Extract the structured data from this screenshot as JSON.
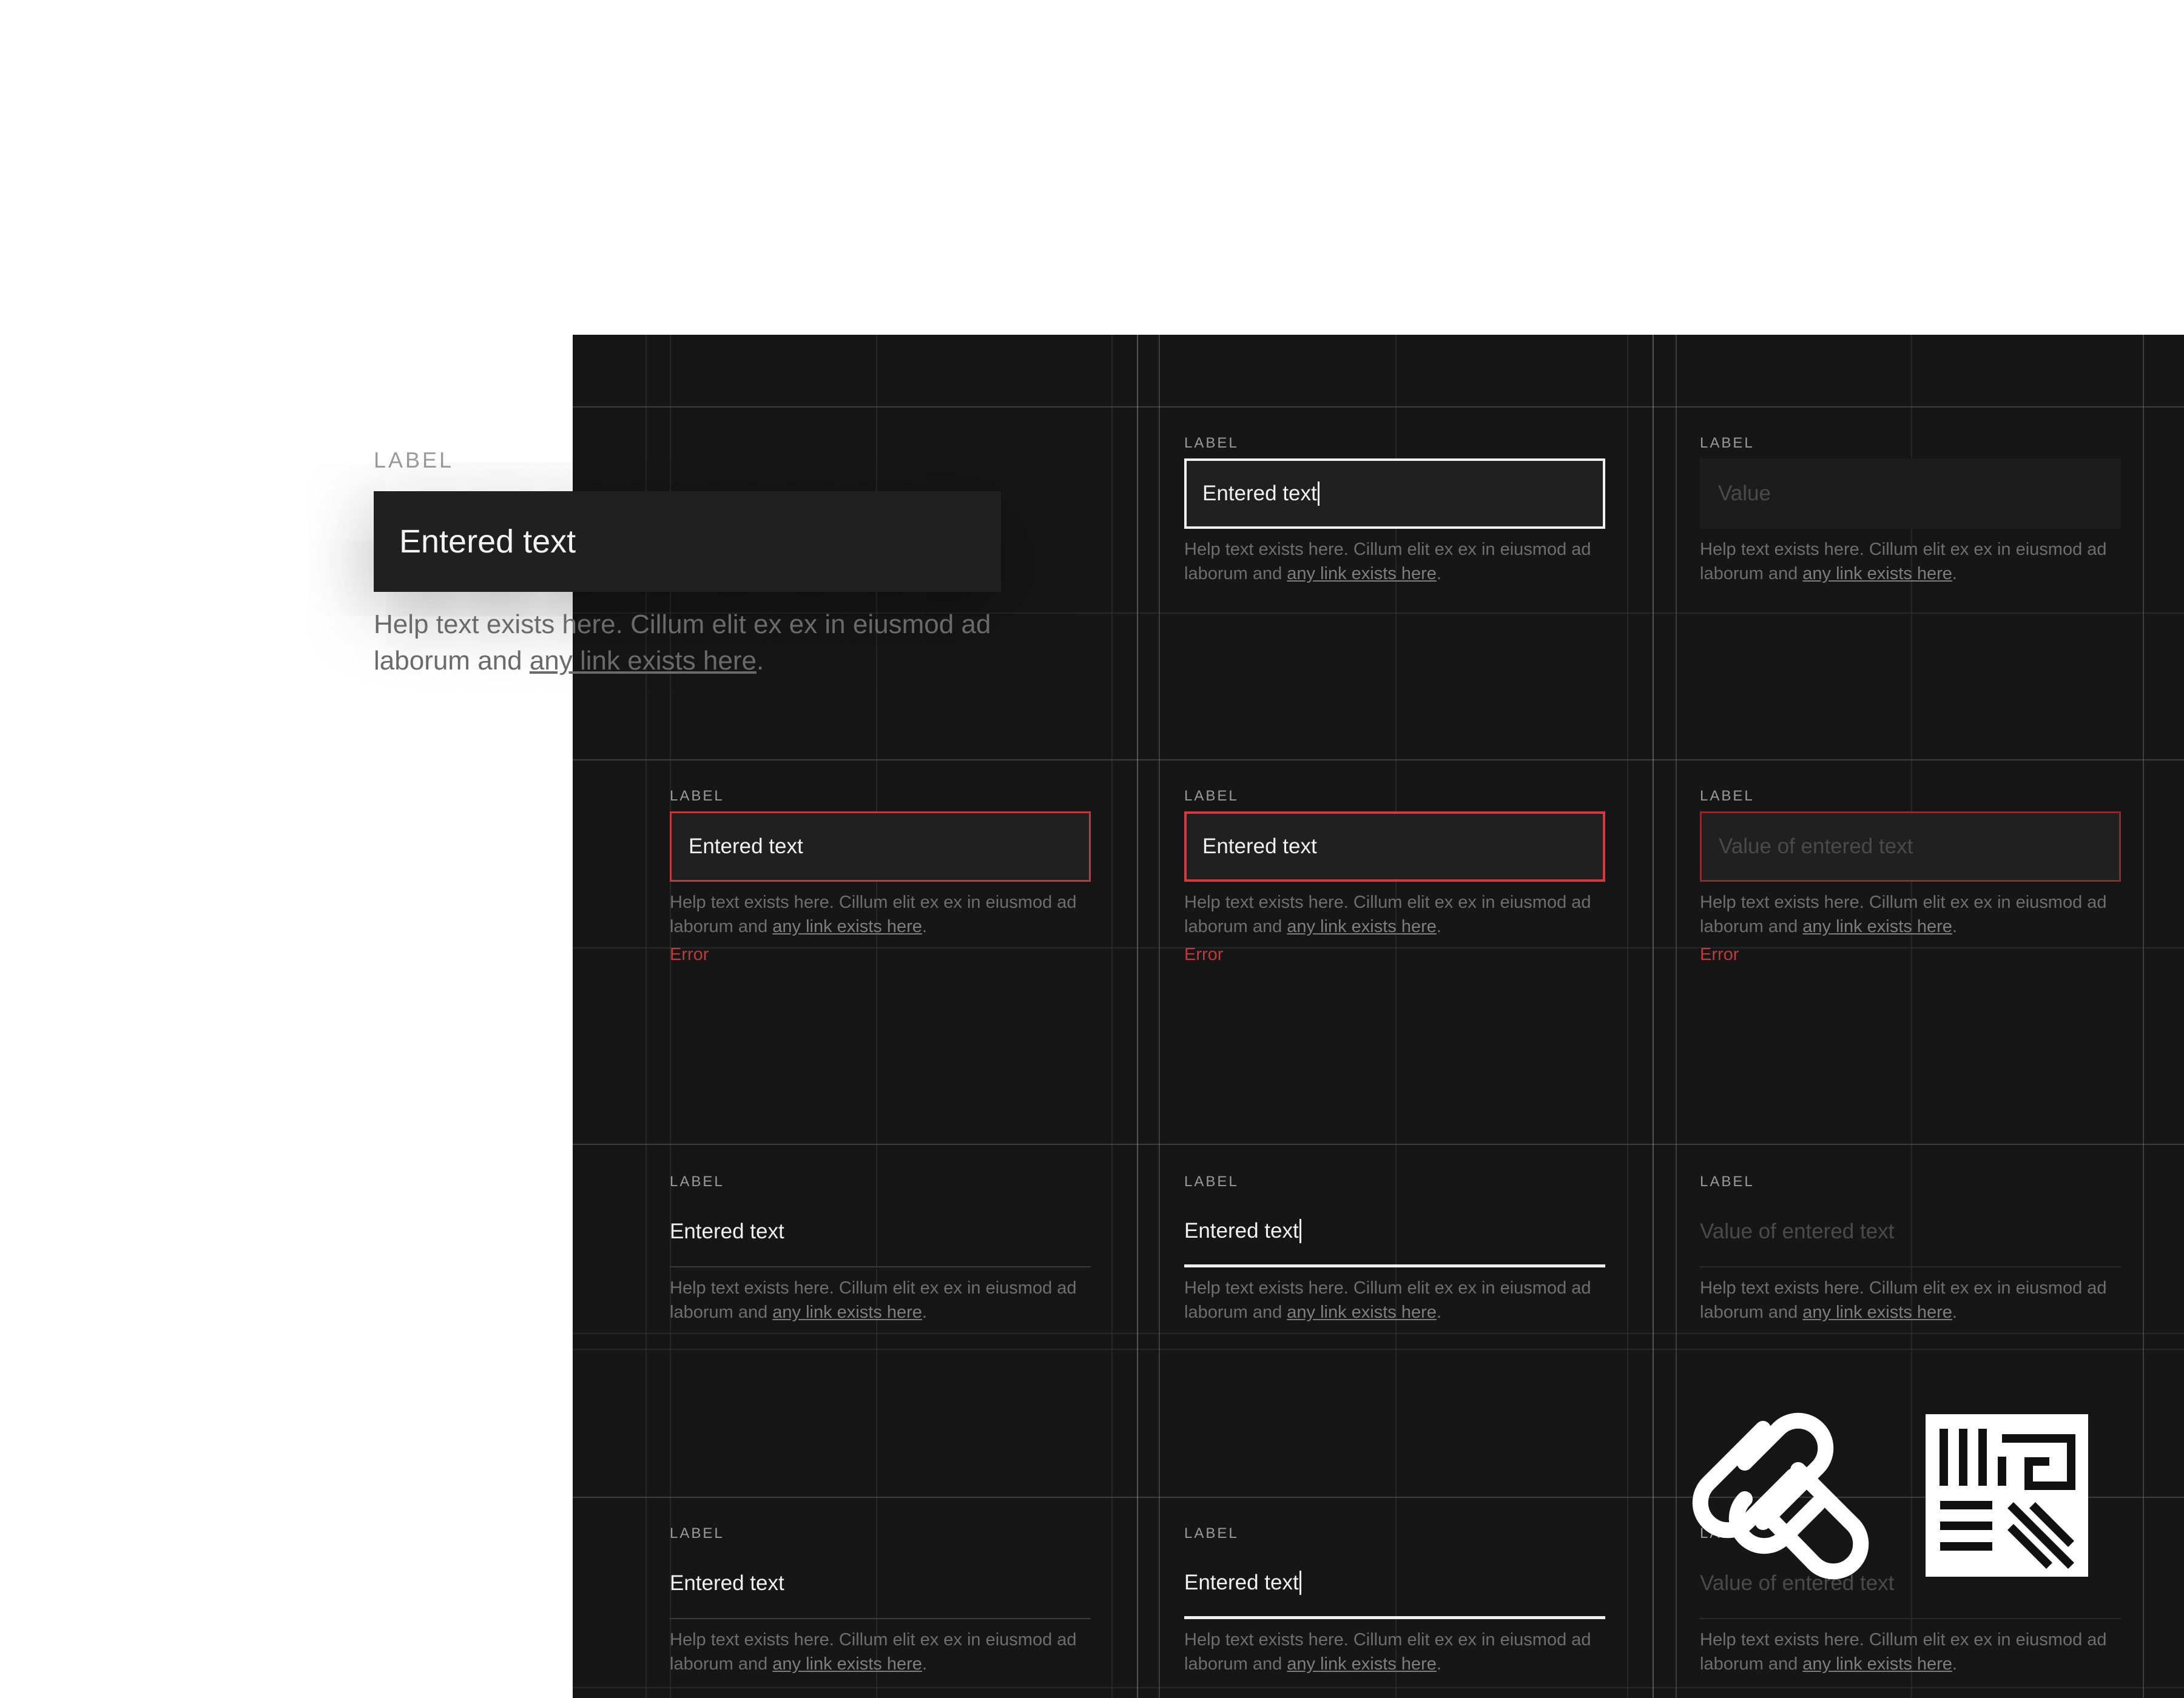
{
  "hero": {
    "label": "LABEL",
    "value": "Entered text",
    "help": "Help text exists here. Cillum elit ex ex in eiusmod ad laborum and ",
    "link": "any link exists here",
    "period": "."
  },
  "common": {
    "label": "LABEL",
    "help": "Help text exists here. Cillum elit ex ex in eiusmod ad laborum and ",
    "link": "any link exists here",
    "period": ".",
    "error": "Error"
  },
  "rows": [
    {
      "cells": [
        null,
        {
          "value": "Entered text",
          "state": "focused"
        },
        {
          "value": "Value",
          "state": "disabled"
        }
      ]
    },
    {
      "cells": [
        {
          "value": "Entered text",
          "state": "error"
        },
        {
          "value": "Entered text",
          "state": "focused-error"
        },
        {
          "value": "Value of entered text",
          "state": "disabled-error"
        }
      ]
    },
    {
      "cells": [
        {
          "value": "Entered text",
          "state": "underline"
        },
        {
          "value": "Entered text",
          "state": "underline-focused"
        },
        {
          "value": "Value of entered text",
          "state": "underline-disabled"
        }
      ]
    },
    {
      "cells": [
        {
          "value": "Entered text",
          "state": "underline"
        },
        {
          "value": "Entered text",
          "state": "underline-focused"
        },
        {
          "value": "Value of entered text",
          "state": "underline-disabled"
        }
      ]
    }
  ],
  "colors": {
    "canvas": "#161616",
    "field": "#202020",
    "error": "#c0393b",
    "text": "#f2f2f2",
    "help": "#6e6e6e"
  },
  "icons": [
    "squarespace-logo-icon",
    "maze-mark-logo-icon"
  ]
}
